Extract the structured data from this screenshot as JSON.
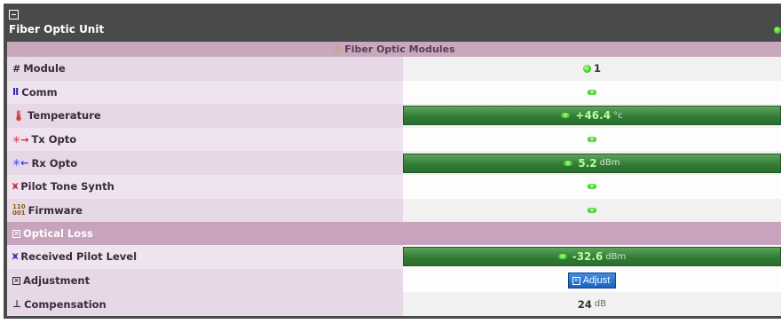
{
  "panel": {
    "title": "Fiber Optic Unit",
    "status_color": "#2fc41d"
  },
  "section": {
    "label": "Fiber Optic Modules",
    "icon": "warning-icon"
  },
  "rows": {
    "module": {
      "label": "Module",
      "value": "1",
      "icon": "hash-icon"
    },
    "comm": {
      "label": "Comm",
      "icon": "comm-icon"
    },
    "temperature": {
      "label": "Temperature",
      "value": "+46.4",
      "unit": "°c",
      "icon": "thermometer-icon"
    },
    "tx_opto": {
      "label": "Tx Opto",
      "icon": "tx-icon"
    },
    "rx_opto": {
      "label": "Rx Opto",
      "value": "5.2",
      "unit": "dBm",
      "icon": "rx-icon"
    },
    "pilot_tone": {
      "label": "Pilot Tone Synth",
      "icon": "pilot-tone-icon"
    },
    "firmware": {
      "label": "Firmware",
      "icon": "binary-icon"
    }
  },
  "optical_loss": {
    "label": "Optical Loss",
    "received_pilot": {
      "label": "Received Pilot Level",
      "value": "-32.6",
      "unit": "dBm"
    },
    "adjustment": {
      "label": "Adjustment",
      "button_label": "Adjust"
    },
    "compensation": {
      "label": "Compensation",
      "value": "24",
      "unit": "dB"
    }
  }
}
